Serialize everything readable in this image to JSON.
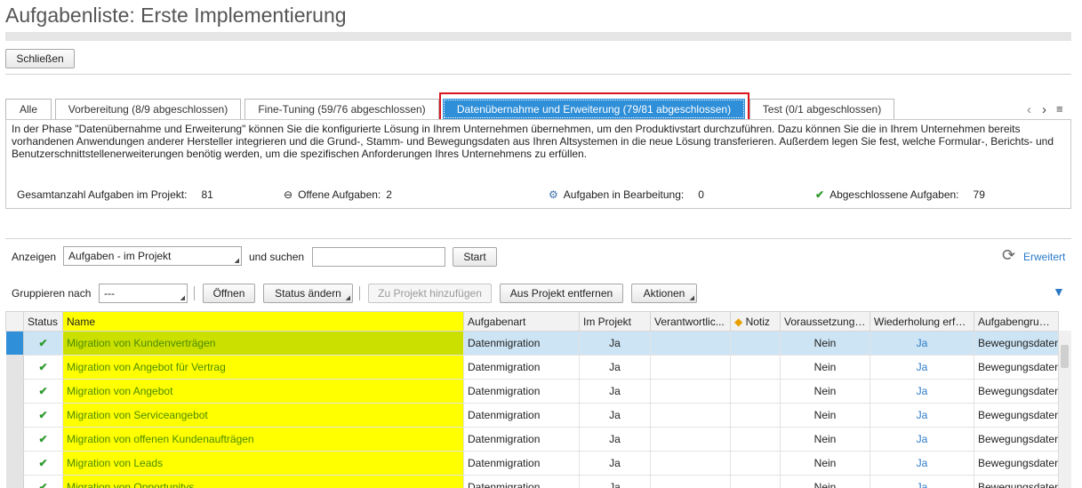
{
  "page": {
    "title": "Aufgabenliste: Erste Implementierung"
  },
  "toolbar": {
    "close_label": "Schließen"
  },
  "tabs": [
    {
      "label": "Alle"
    },
    {
      "label": "Vorbereitung (8/9 abgeschlossen)"
    },
    {
      "label": "Fine-Tuning (59/76 abgeschlossen)"
    },
    {
      "label": "Datenübernahme und Erweiterung (79/81 abgeschlossen)",
      "active": true
    },
    {
      "label": "Test (0/1 abgeschlossen)"
    }
  ],
  "phase": {
    "description": "In der Phase \"Datenübernahme und Erweiterung\" können Sie die konfigurierte Lösung in Ihrem Unternehmen übernehmen, um den Produktivstart durchzuführen. Dazu können Sie die in Ihrem Unternehmen bereits vorhandenen Anwendungen anderer Hersteller integrieren und die Grund-, Stamm- und Bewegungsdaten aus Ihren Altsystemen in die neue Lösung transferieren. Außerdem legen Sie fest, welche Formular-, Berichts- und Benutzerschnittstellenerweiterungen benötig werden, um die spezifischen Anforderungen Ihres Unternehmens zu erfüllen.",
    "stats": {
      "total_label": "Gesamtanzahl Aufgaben im Projekt:",
      "total_value": "81",
      "open_label": "Offene Aufgaben:",
      "open_value": "2",
      "inprogress_label": "Aufgaben in Bearbeitung:",
      "inprogress_value": "0",
      "done_label": "Abgeschlossene Aufgaben:",
      "done_value": "79"
    }
  },
  "filter": {
    "show_label": "Anzeigen",
    "show_value": "Aufgaben - im Projekt",
    "search_label": "und suchen",
    "search_value": "",
    "start_label": "Start",
    "advanced_label": "Erweitert"
  },
  "group": {
    "label": "Gruppieren nach",
    "value": "---",
    "open_label": "Öffnen",
    "status_label": "Status ändern",
    "add_label": "Zu Projekt hinzufügen",
    "remove_label": "Aus Projekt entfernen",
    "actions_label": "Aktionen"
  },
  "table": {
    "headers": {
      "status": "Status",
      "name": "Name",
      "type": "Aufgabenart",
      "inproject": "Im Projekt",
      "owner": "Verantwortlic...",
      "note": "Notiz",
      "prereq": "Voraussetzunge...",
      "repeat": "Wiederholung erfo...",
      "group": "Aufgabengruppe"
    },
    "rows": [
      {
        "name": "Migration von Kundenverträgen",
        "type": "Datenmigration",
        "inproject": "Ja",
        "prereq": "Nein",
        "repeat": "Ja",
        "group": "Bewegungsdaten"
      },
      {
        "name": "Migration von Angebot für Vertrag",
        "type": "Datenmigration",
        "inproject": "Ja",
        "prereq": "Nein",
        "repeat": "Ja",
        "group": "Bewegungsdaten"
      },
      {
        "name": "Migration von Angebot",
        "type": "Datenmigration",
        "inproject": "Ja",
        "prereq": "Nein",
        "repeat": "Ja",
        "group": "Bewegungsdaten"
      },
      {
        "name": "Migration von Serviceangebot",
        "type": "Datenmigration",
        "inproject": "Ja",
        "prereq": "Nein",
        "repeat": "Ja",
        "group": "Bewegungsdaten"
      },
      {
        "name": "Migration von offenen Kundenaufträgen",
        "type": "Datenmigration",
        "inproject": "Ja",
        "prereq": "Nein",
        "repeat": "Ja",
        "group": "Bewegungsdaten"
      },
      {
        "name": "Migration von Leads",
        "type": "Datenmigration",
        "inproject": "Ja",
        "prereq": "Nein",
        "repeat": "Ja",
        "group": "Bewegungsdaten"
      },
      {
        "name": "Migration von Opportunitys",
        "type": "Datenmigration",
        "inproject": "Ja",
        "prereq": "Nein",
        "repeat": "Ja",
        "group": "Bewegungsdaten"
      }
    ]
  },
  "colors": {
    "accent": "#2f8fd8",
    "highlight": "#ffff00",
    "tab_outline": "#d9141c",
    "link": "#2a7ac8"
  },
  "icons": {
    "status": "check-icon",
    "note": "note-icon",
    "refresh": "refresh-icon",
    "filter": "filter-icon"
  }
}
